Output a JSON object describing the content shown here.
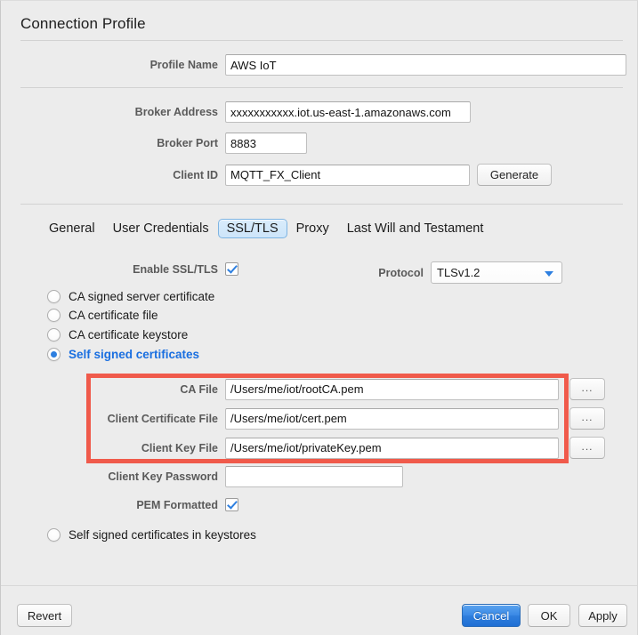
{
  "window": {
    "title": "Connection Profile"
  },
  "profile": {
    "name_label": "Profile Name",
    "name_value": "AWS IoT"
  },
  "broker": {
    "address_label": "Broker Address",
    "address_value": "xxxxxxxxxxx.iot.us-east-1.amazonaws.com",
    "port_label": "Broker Port",
    "port_value": "8883",
    "client_id_label": "Client ID",
    "client_id_value": "MQTT_FX_Client",
    "generate_label": "Generate"
  },
  "tabs": [
    {
      "label": "General",
      "selected": false
    },
    {
      "label": "User Credentials",
      "selected": false
    },
    {
      "label": "SSL/TLS",
      "selected": true
    },
    {
      "label": "Proxy",
      "selected": false
    },
    {
      "label": "Last Will and Testament",
      "selected": false
    }
  ],
  "ssl": {
    "enable_label": "Enable SSL/TLS",
    "enable_checked": true,
    "protocol_label": "Protocol",
    "protocol_value": "TLSv1.2",
    "protocol_options": [
      "TLSv1.2"
    ],
    "cert_modes": [
      {
        "label": "CA signed server certificate",
        "selected": false
      },
      {
        "label": "CA certificate file",
        "selected": false
      },
      {
        "label": "CA certificate keystore",
        "selected": false
      },
      {
        "label": "Self signed certificates",
        "selected": true
      }
    ],
    "ca_file_label": "CA File",
    "ca_file_value": "/Users/me/iot/rootCA.pem",
    "client_cert_label": "Client Certificate File",
    "client_cert_value": "/Users/me/iot/cert.pem",
    "client_key_label": "Client Key File",
    "client_key_value": "/Users/me/iot/privateKey.pem",
    "browse_label": "...",
    "key_password_label": "Client Key Password",
    "key_password_value": "",
    "pem_label": "PEM Formatted",
    "pem_checked": true,
    "keystore_mode_label": "Self signed certificates in keystores",
    "keystore_mode_selected": false
  },
  "footer": {
    "revert_label": "Revert",
    "cancel_label": "Cancel",
    "ok_label": "OK",
    "apply_label": "Apply"
  },
  "colors": {
    "accent": "#2d7fe0",
    "annotation": "#f05a4b",
    "background": "#ececec"
  }
}
